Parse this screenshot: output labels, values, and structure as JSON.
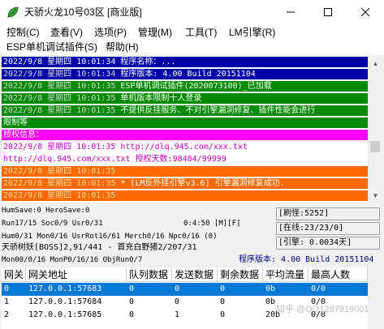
{
  "window": {
    "title": "天骄火龙10号03区 [商业版]",
    "icon": "leaf-app-icon"
  },
  "menu": {
    "items": [
      "控制(C)",
      "查看(V)",
      "选项(P)",
      "管理(M)",
      "工具(T)",
      "LM引擎(R)",
      "ESP单机调试插件(S)",
      "帮助(H)"
    ]
  },
  "log": {
    "lines": [
      {
        "ts": "",
        "text": "2022/9/8 星期四 10:01:34 程序名称：...",
        "style": "bg-blue"
      },
      {
        "ts": "2022/9/8 星期四 10:01:34",
        "text": " 程序版本: 4.00 Build 20151104",
        "style": "bg-blue"
      },
      {
        "ts": "2022/9/8 星期四 10:01:35",
        "text": " ESP单机调试插件(2020073100)_已加载",
        "style": "bg-green"
      },
      {
        "ts": "2022/9/8 星期四 10:01:35",
        "text": " 单机版本限制十人登录",
        "style": "bg-green"
      },
      {
        "ts": "2022/9/8 星期四 10:01:35",
        "text": " 不提供反挂服务、不对引擎漏洞修复、插件性能会进行",
        "style": "bg-green"
      },
      {
        "ts": "",
        "text": "限制等",
        "style": "bg-green"
      },
      {
        "ts": "",
        "text": "授权信息：",
        "style": "bg-mag"
      },
      {
        "ts": "2022/9/8 星期四 10:01:35",
        "text": " http://dlq.945.com/xxx.txt",
        "style": "fg-mag"
      },
      {
        "ts": "",
        "text": "http://dlq.945.com/xxx.txt 授权天数:98484/99999",
        "style": "fg-mag"
      },
      {
        "ts": "2022/9/8 星期四 10:01:35",
        "text": " ",
        "style": "bg-orange"
      },
      {
        "ts": "2022/9/8 星期四 10:01:35",
        "text": " * [LM反外挂引擎v3.6] 引擎漏洞修复成功.",
        "style": "bg-orange"
      },
      {
        "ts": "2022/9/8 星期四 10:01:35",
        "text": " ",
        "style": "bg-orange"
      }
    ]
  },
  "stats": {
    "lines": [
      "HumSave:0 HeroSave:0",
      "Run17/15 Soc0/9 Usr0/31",
      "Hum0/31 Mon0/16 UsrRot16/61 Merch0/16 Npc0/16 (0)",
      "天骄树妖[BOSS]2,91/441 - 首充白野猪2/207/31",
      "Mon00/0/16 MonP0/16/16 ObjRun0/7"
    ],
    "timer": "0:4:50 [M][F]",
    "boxes": [
      "[刷怪:5252]",
      "[在线:23/23/0]",
      "[引擎: 0.0034天]"
    ],
    "version": "程序版本: 4.00 Build 20151104"
  },
  "table": {
    "columns": [
      "网关",
      "网关地址",
      "队列数据",
      "发送数据",
      "剩余数据",
      "平均流量",
      "最高人数"
    ],
    "rows": [
      [
        "0",
        "127.0.0.1:57683",
        "0",
        "0",
        "0",
        "0b",
        "0/0"
      ],
      [
        "1",
        "127.0.0.1:57684",
        "0",
        "0",
        "0",
        "0b",
        "0/0"
      ],
      [
        "2",
        "127.0.0.1:57685",
        "0",
        "1",
        "0",
        "20b",
        "0/0"
      ]
    ]
  },
  "watermark": "知乎 @QQ1287919001",
  "colors": {
    "log_blue": "#0000a8",
    "log_green": "#008a00",
    "log_magenta": "#ff00ff",
    "log_orange": "#ff6a00",
    "selection": "#0078d7",
    "version_text": "#000080"
  }
}
